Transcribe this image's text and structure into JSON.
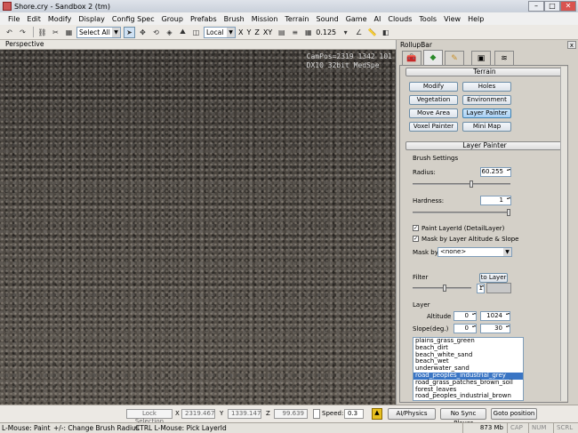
{
  "window": {
    "title": "Shore.cry - Sandbox 2 (tm)"
  },
  "menu": [
    "File",
    "Edit",
    "Modify",
    "Display",
    "Config Spec",
    "Group",
    "Prefabs",
    "Brush",
    "Mission",
    "Terrain",
    "Sound",
    "Game",
    "AI",
    "Clouds",
    "Tools",
    "View",
    "Help"
  ],
  "toolbar": {
    "select_all": "Select All",
    "coord_system": "Local",
    "axis_x": "X",
    "axis_y": "Y",
    "axis_z": "Z",
    "axis_xy": "XY",
    "snap_value": "0.125"
  },
  "viewport": {
    "label": "Perspective",
    "cam_line1": "CamPos=2319 1342 101",
    "cam_line2": "DX10 32bit MedSpe"
  },
  "rollup": {
    "title": "RollupBar",
    "close": "x",
    "terrain_header": "Terrain",
    "buttons": [
      "Modify",
      "Holes",
      "Vegetation",
      "Environment",
      "Move Area",
      "Layer Painter",
      "Voxel Painter",
      "Mini Map"
    ],
    "layer_painter_header": "Layer Painter",
    "brush_settings": "Brush Settings",
    "radius_label": "Radius:",
    "radius_value": "60.255",
    "radius_fraction": 0.6,
    "hardness_label": "Hardness:",
    "hardness_value": "1",
    "hardness_fraction": 1.0,
    "paint_layer_id": "Paint LayerId (DetailLayer)",
    "mask_altitude": "Mask by Layer Altitude & Slope",
    "mask_by_label": "Mask by",
    "mask_by_value": "<none>",
    "filter_label": "Filter",
    "to_layer": "to Layer",
    "filter_value": "1",
    "layer_label": "Layer",
    "altitude_label": "Altitude",
    "altitude_min": "0",
    "altitude_max": "1024",
    "slope_label": "Slope(deg.)",
    "slope_min": "0",
    "slope_max": "30",
    "layers": [
      "plains_grass_green",
      "beach_dirt",
      "beach_white_sand",
      "beach_wet",
      "underwater_sand",
      "road_peoples_industrial_grey",
      "road_grass_patches_brown_soil",
      "forest_leaves",
      "road_peoples_industrial_brown"
    ],
    "selected_layer": "road_peoples_industrial_grey"
  },
  "bottombar": {
    "lock_selection": "Lock Selection",
    "x_label": "X",
    "x_value": "2319.467",
    "y_label": "Y",
    "y_value": "1339.147",
    "z_label": "Z",
    "z_value": "99.639",
    "speed_label": "Speed:",
    "speed_value": "0.3",
    "ai_physics": "AI/Physics",
    "no_sync_player": "No Sync Player",
    "goto_position": "Goto position"
  },
  "status": {
    "hint1": "L-Mouse: Paint",
    "hint2": "+/-: Change Brush Radius",
    "hint3": "CTRL L-Mouse: Pick LayerId",
    "memory": "873 Mb",
    "cap": "CAP",
    "num": "NUM",
    "scrl": "SCRL"
  }
}
